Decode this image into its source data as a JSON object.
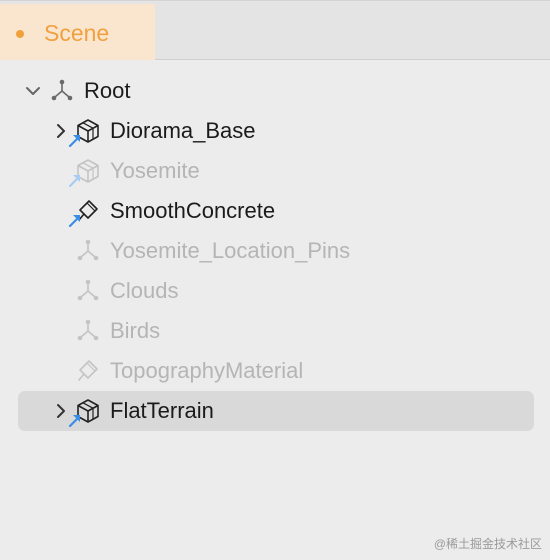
{
  "panel": {
    "tab": {
      "label": "Scene",
      "accent": "#f0a13e"
    }
  },
  "tree": [
    {
      "label": "Root",
      "icon": "transform-node-icon",
      "expandable": true,
      "expanded": true,
      "dimmed": false,
      "selected": false,
      "linked": false
    },
    {
      "label": "Diorama_Base",
      "icon": "model-cube-icon",
      "expandable": true,
      "expanded": false,
      "dimmed": false,
      "selected": false,
      "linked": true
    },
    {
      "label": "Yosemite",
      "icon": "model-cube-icon",
      "expandable": false,
      "expanded": false,
      "dimmed": true,
      "selected": false,
      "linked": true
    },
    {
      "label": "SmoothConcrete",
      "icon": "material-icon",
      "expandable": false,
      "expanded": false,
      "dimmed": false,
      "selected": false,
      "linked": true
    },
    {
      "label": "Yosemite_Location_Pins",
      "icon": "transform-node-icon",
      "expandable": false,
      "expanded": false,
      "dimmed": true,
      "selected": false,
      "linked": false
    },
    {
      "label": "Clouds",
      "icon": "transform-node-icon",
      "expandable": false,
      "expanded": false,
      "dimmed": true,
      "selected": false,
      "linked": false
    },
    {
      "label": "Birds",
      "icon": "transform-node-icon",
      "expandable": false,
      "expanded": false,
      "dimmed": true,
      "selected": false,
      "linked": false
    },
    {
      "label": "TopographyMaterial",
      "icon": "material-icon",
      "expandable": false,
      "expanded": false,
      "dimmed": true,
      "selected": false,
      "linked": false
    },
    {
      "label": "FlatTerrain",
      "icon": "model-cube-icon",
      "expandable": true,
      "expanded": false,
      "dimmed": false,
      "selected": true,
      "linked": true
    }
  ],
  "watermark": "@稀土掘金技术社区"
}
